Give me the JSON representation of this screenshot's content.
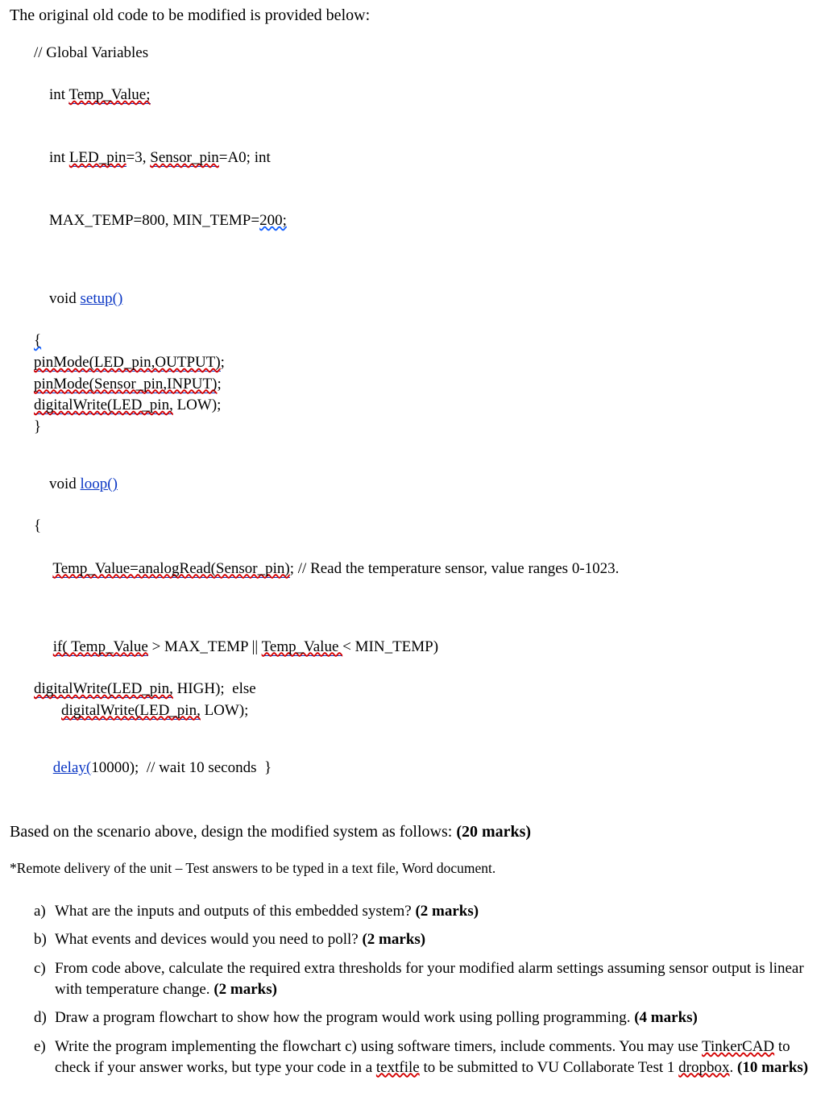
{
  "intro": "The original old code to be modified is provided below:",
  "code": {
    "c1": "// Global Variables",
    "c2_a": "int ",
    "c2_b": "Temp_Value;",
    "c3_a": "int ",
    "c3_b": "LED_pin",
    "c3_c": "=3, ",
    "c3_d": "Sensor_pin",
    "c3_e": "=A0; int",
    "c4_a": "MAX_TEMP=800, MIN_TEMP=",
    "c4_b": "200;",
    "c5_a": "void ",
    "c5_b": "setup()",
    "c6": "{",
    "c7_a": "pinMode(LED_pin,OUTPUT)",
    "c7_b": ";",
    "c8_a": "pinMode(Sensor_pin,INPUT)",
    "c8_b": ";",
    "c9_a": "digitalWrite(LED_pin,",
    "c9_b": " LOW);",
    "c10": "}",
    "c11_a": "void ",
    "c11_b": "loop()",
    "c12": "{",
    "c13_a": " ",
    "c13_b": "Temp_Value=analogRead(Sensor_pin)",
    "c13_c": "; // Read the temperature sensor, value ranges 0-1023.",
    "c14_a": " ",
    "c14_b": "if( Temp_Value",
    "c14_c": " > MAX_TEMP || ",
    "c14_d": "Temp_Value ",
    "c14_e": "< MIN_TEMP)",
    "c15_a": "digitalWrite(LED_pin,",
    "c15_b": " HIGH);  else",
    "c16_a": "digitalWrite(LED_pin,",
    "c16_b": " LOW);",
    "c17_a": " ",
    "c17_b": "delay(",
    "c17_c": "10000);  // wait 10 seconds  }"
  },
  "prompt_a": "Based on the scenario above, design the modified system as follows: ",
  "prompt_b": "(20 marks)",
  "note": "*Remote delivery of the unit – Test answers to be typed in a text file, Word document.",
  "q": {
    "a": {
      "lbl": "a)",
      "t1": "What are the inputs and outputs of this embedded system? ",
      "m": "(2 marks)"
    },
    "b": {
      "lbl": "b)",
      "t1": "What events and devices would you need to poll? ",
      "m": "(2 marks)"
    },
    "c": {
      "lbl": "c)",
      "t1": "From code above, calculate the required extra thresholds for your modified alarm settings assuming sensor output is linear with temperature change. ",
      "m": "(2 marks)"
    },
    "d": {
      "lbl": "d)",
      "t1": "Draw a program flowchart to show how the program would work using polling programming. ",
      "m": "(4 marks)"
    },
    "e": {
      "lbl": "e)",
      "t1": "Write the program implementing the flowchart c) using software timers, include comments. You may use ",
      "tkr": "TinkerCAD",
      "t2": " to check if your answer works, but type your code in a ",
      "tf": "textfile",
      "t3": " to be submitted to VU Collaborate Test 1 ",
      "db": "dropbox",
      "t4": ". ",
      "m": "(10 marks)"
    }
  }
}
